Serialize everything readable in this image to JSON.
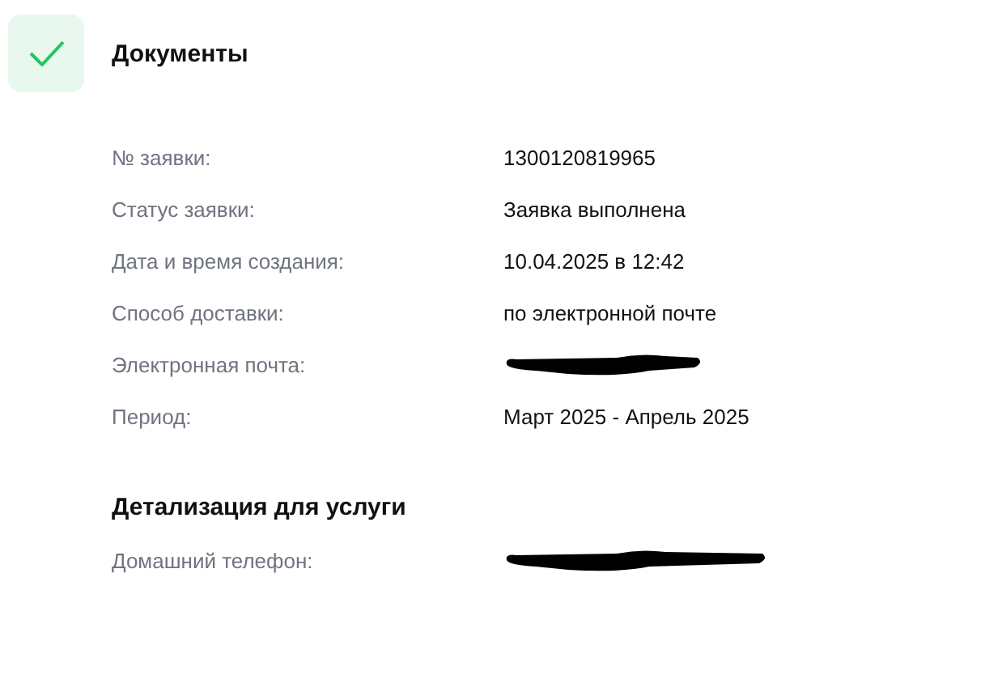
{
  "header": {
    "title": "Документы",
    "completed": true
  },
  "details": [
    {
      "label": "№ заявки:",
      "kind": "text",
      "value": "1300120819965"
    },
    {
      "label": "Статус заявки:",
      "kind": "text",
      "value": "Заявка выполнена"
    },
    {
      "label": "Дата и время создания:",
      "kind": "text",
      "value": "10.04.2025 в 12:42"
    },
    {
      "label": "Способ доставки:",
      "kind": "text",
      "value": "по электронной почте"
    },
    {
      "label": "Электронная почта:",
      "kind": "redacted"
    },
    {
      "label": "Период:",
      "kind": "text",
      "value": "Март 2025 - Апрель 2025"
    }
  ],
  "service_section": {
    "title": "Детализация для услуги",
    "rows": [
      {
        "label": "Домашний телефон:",
        "kind": "redacted"
      }
    ]
  }
}
